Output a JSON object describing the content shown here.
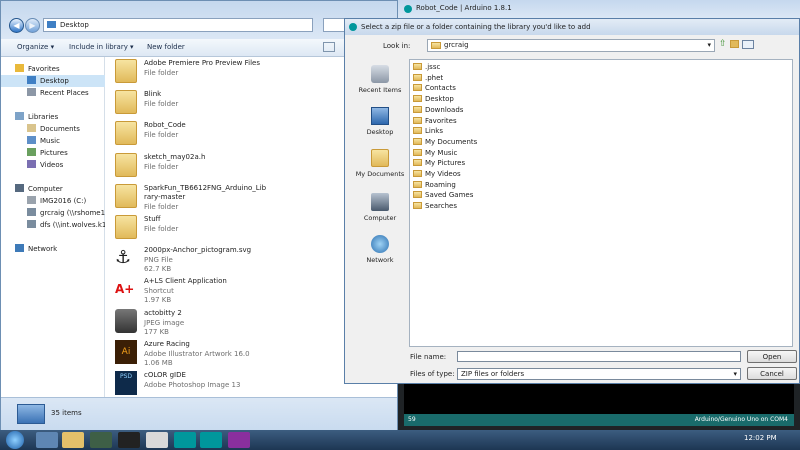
{
  "explorer": {
    "address": "Desktop",
    "toolbar": {
      "organize": "Organize ▾",
      "include": "Include in library ▾",
      "new_folder": "New folder"
    },
    "nav": [
      {
        "label": "Favorites",
        "type": "star"
      },
      {
        "label": "Desktop",
        "type": "desktop"
      },
      {
        "label": "Recent Places",
        "type": "recent"
      },
      {
        "label": "",
        "type": "gap"
      },
      {
        "label": "Libraries",
        "type": "lib"
      },
      {
        "label": "Documents",
        "type": "doc"
      },
      {
        "label": "Music",
        "type": "music"
      },
      {
        "label": "Pictures",
        "type": "pic"
      },
      {
        "label": "Videos",
        "type": "video"
      },
      {
        "label": "",
        "type": "gap"
      },
      {
        "label": "Computer",
        "type": "computer"
      },
      {
        "label": "IMG2016 (C:)",
        "type": "drive"
      },
      {
        "label": "grcraig (\\\\rshome1\\",
        "type": "net"
      },
      {
        "label": "dfs (\\\\int.wolves.k12",
        "type": "net"
      },
      {
        "label": "",
        "type": "gap"
      },
      {
        "label": "Network",
        "type": "network"
      }
    ],
    "files": [
      {
        "name": "Adobe Premiere Pro Preview Files",
        "type": "File folder",
        "size": "",
        "icon": "folder"
      },
      {
        "name": "Blink",
        "type": "File folder",
        "size": "",
        "icon": "folder"
      },
      {
        "name": "Robot_Code",
        "type": "File folder",
        "size": "",
        "icon": "folder"
      },
      {
        "name": "sketch_may02a.h",
        "type": "File folder",
        "size": "",
        "icon": "folder"
      },
      {
        "name": "SparkFun_TB6612FNG_Arduino_Lib",
        "name2": "rary-master",
        "type": "File folder",
        "size": "",
        "icon": "folder"
      },
      {
        "name": "Stuff",
        "type": "File folder",
        "size": "",
        "icon": "folder"
      },
      {
        "name": "2000px-Anchor_pictogram.svg",
        "type": "PNG File",
        "size": "62.7 KB",
        "icon": "anchor"
      },
      {
        "name": "A+LS Client Application",
        "type": "Shortcut",
        "size": "1.97 KB",
        "icon": "als"
      },
      {
        "name": "actobitty 2",
        "type": "JPEG image",
        "size": "177 KB",
        "icon": "robot"
      },
      {
        "name": "Azure Racing",
        "type": "Adobe Illustrator Artwork 16.0",
        "size": "1.06 MB",
        "icon": "ai"
      },
      {
        "name": "cOLOR gIDE",
        "type": "Adobe Photoshop Image 13",
        "size": "",
        "icon": "psd"
      }
    ],
    "items_count": "35 items"
  },
  "dialog": {
    "title": "Select a zip file or a folder containing the library you'd like to add",
    "look_in_label": "Look in:",
    "look_in_value": "grcraig",
    "places": [
      "Recent Items",
      "Desktop",
      "My Documents",
      "Computer",
      "Network"
    ],
    "entries": [
      ".jssc",
      ".phet",
      "Contacts",
      "Desktop",
      "Downloads",
      "Favorites",
      "Links",
      "My Documents",
      "My Music",
      "My Pictures",
      "My Videos",
      "Roaming",
      "Saved Games",
      "Searches"
    ],
    "file_name_label": "File name:",
    "file_name_value": "",
    "files_of_type_label": "Files of type:",
    "files_of_type_value": "ZIP files or folders",
    "open": "Open",
    "cancel": "Cancel"
  },
  "ide": {
    "title": "Robot_Code | Arduino 1.8.1",
    "line": "59",
    "board": "Arduino/Genuino Uno on COM4"
  },
  "taskbar": {
    "time": "12:02 PM"
  }
}
